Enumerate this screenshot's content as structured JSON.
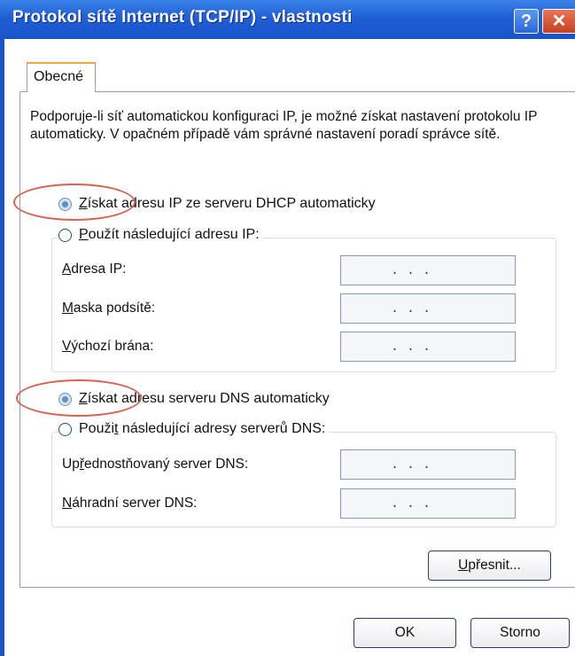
{
  "window": {
    "title": "Protokol sítě Internet (TCP/IP) - vlastnosti",
    "help_glyph": "?",
    "close_glyph": "✕"
  },
  "tabs": [
    {
      "label": "Obecné",
      "selected": true
    }
  ],
  "description": "Podporuje-li síť automatickou konfiguraci IP, je možné získat nastavení protokolu IP automaticky. V opačném případě vám správné nastavení poradí správce sítě.",
  "ip_section": {
    "auto_option": {
      "mnemonic": "Z",
      "rest": "ískat adresu IP ze serveru DHCP automaticky",
      "selected": true
    },
    "manual_option": {
      "mnemonic": "P",
      "rest": "oužít následující adresu IP:",
      "selected": false
    },
    "fields": [
      {
        "mnemonic": "A",
        "rest": "dresa IP:",
        "value": ". . ."
      },
      {
        "mnemonic": "M",
        "rest": "aska podsítě:",
        "value": ". . ."
      },
      {
        "mnemonic": "V",
        "rest": "ýchozí brána:",
        "value": ". . ."
      }
    ]
  },
  "dns_section": {
    "auto_option": {
      "mnemonic": "Z",
      "rest": "ískat adresu serveru DNS automaticky",
      "selected": true
    },
    "manual_option": {
      "prefix": "Použi",
      "mnemonic": "t",
      "rest": " následující adresy serverů DNS:",
      "selected": false
    },
    "fields": [
      {
        "prefix": "Up",
        "mnemonic": "ř",
        "rest": "ednostňovaný server DNS:",
        "value": ". . ."
      },
      {
        "prefix": "",
        "mnemonic": "N",
        "rest": "áhradní server DNS:",
        "value": ". . ."
      }
    ]
  },
  "buttons": {
    "advanced": {
      "mnemonic": "U",
      "rest": "přesnit..."
    },
    "ok": "OK",
    "cancel": "Storno"
  },
  "colors": {
    "titlebar": "#1f5fd6",
    "annotation_circle": "#d9614f",
    "border": "#8aa2c4"
  }
}
